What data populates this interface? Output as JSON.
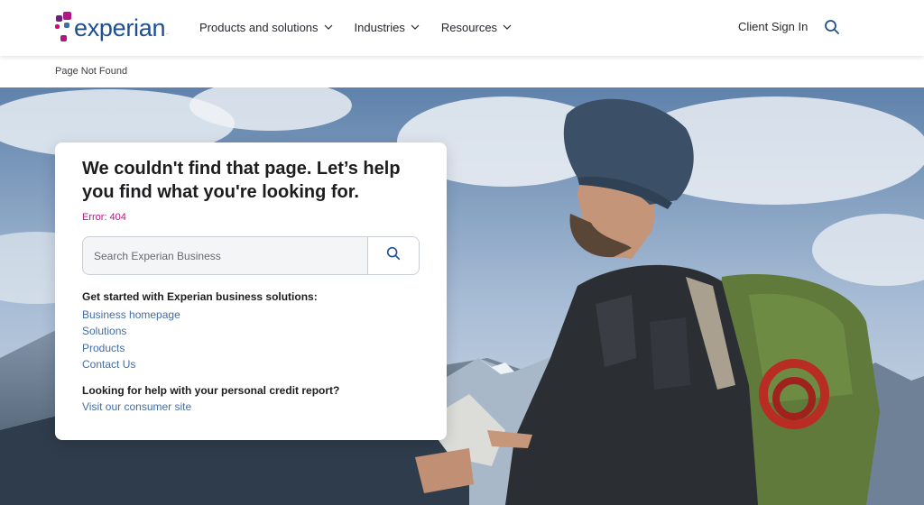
{
  "header": {
    "logo_text": "experian",
    "logo_tm": ".",
    "nav": [
      {
        "label": "Products and solutions"
      },
      {
        "label": "Industries"
      },
      {
        "label": "Resources"
      }
    ],
    "client_sign_in": "Client Sign In"
  },
  "breadcrumb": "Page Not Found",
  "card": {
    "title": "We couldn't find that page. Let’s help you find what you're looking for.",
    "error": "Error: 404",
    "search_placeholder": "Search Experian Business",
    "business_heading": "Get started with Experian business solutions:",
    "links": [
      {
        "label": "Business homepage"
      },
      {
        "label": "Solutions"
      },
      {
        "label": "Products"
      },
      {
        "label": "Contact Us"
      }
    ],
    "consumer_heading": "Looking for help with your personal credit report?",
    "consumer_link": "Visit our consumer site"
  },
  "colors": {
    "brand_blue": "#1d4f91",
    "brand_magenta": "#af1685",
    "link_blue": "#426da9",
    "logo_dots": [
      "#6d2077",
      "#af1685",
      "#e5007e",
      "#426da9"
    ]
  },
  "icons": [
    "search-icon",
    "chevron-down-icon"
  ]
}
